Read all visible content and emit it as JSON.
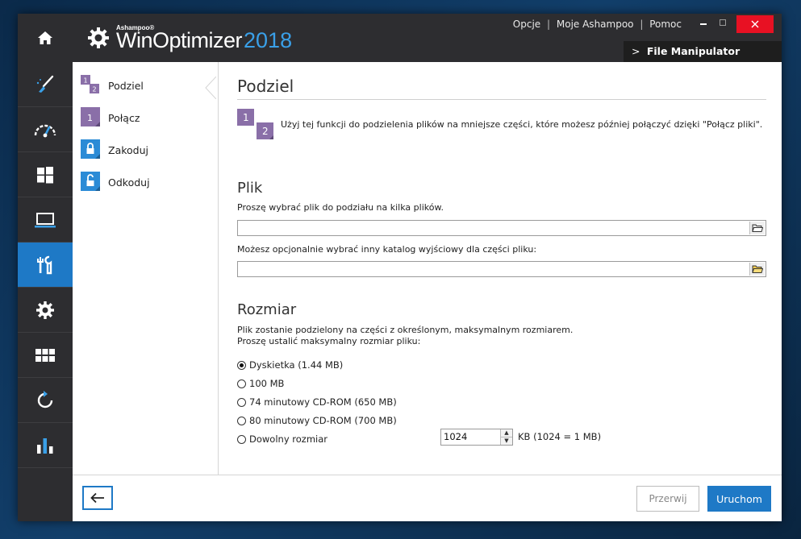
{
  "app": {
    "brand_small": "Ashampoo®",
    "name": "WinOptimizer",
    "year": "2018"
  },
  "top_menu": {
    "options": "Opcje",
    "my_ashampoo": "Moje Ashampoo",
    "help": "Pomoc",
    "separator": "|"
  },
  "breadcrumb": {
    "chevron": ">",
    "label": "File Manipulator"
  },
  "sidebar": {
    "items": [
      {
        "icon": "broom-icon"
      },
      {
        "icon": "speedometer-icon"
      },
      {
        "icon": "windows-icon"
      },
      {
        "icon": "laptop-icon"
      },
      {
        "icon": "tools-icon",
        "active": true
      },
      {
        "icon": "gear-icon"
      },
      {
        "icon": "grid-icon"
      },
      {
        "icon": "restore-icon"
      },
      {
        "icon": "stats-icon"
      }
    ]
  },
  "subnav": {
    "items": [
      {
        "label": "Podziel",
        "icon": "split-icon",
        "active": true
      },
      {
        "label": "Połącz",
        "icon": "merge-icon"
      },
      {
        "label": "Zakoduj",
        "icon": "lock-icon"
      },
      {
        "label": "Odkoduj",
        "icon": "unlock-icon"
      }
    ]
  },
  "main": {
    "title": "Podziel",
    "intro": "Użyj tej funkcji do podzielenia plików na mniejsze części, które możesz później połączyć dzięki \"Połącz pliki\".",
    "file_section": {
      "heading": "Plik",
      "file_label": "Proszę wybrać plik do podziału na kilka plików.",
      "file_value": "",
      "dir_label": "Możesz opcjonalnie wybrać inny katalog wyjściowy dla części pliku:",
      "dir_value": ""
    },
    "size_section": {
      "heading": "Rozmiar",
      "desc_line1": "Plik zostanie podzielony na części z określonym, maksymalnym rozmiarem.",
      "desc_line2": "Proszę ustalić maksymalny rozmiar pliku:",
      "options": [
        {
          "label": "Dyskietka (1.44 MB)",
          "checked": true
        },
        {
          "label": "100 MB",
          "checked": false
        },
        {
          "label": "74 minutowy CD-ROM (650 MB)",
          "checked": false
        },
        {
          "label": "80 minutowy CD-ROM (700 MB)",
          "checked": false
        },
        {
          "label": "Dowolny rozmiar",
          "checked": false
        }
      ],
      "custom_value": "1024",
      "unit_label": "KB (1024 = 1 MB)"
    }
  },
  "footer": {
    "back_icon": "arrow-left-icon",
    "cancel_label": "Przerwij",
    "run_label": "Uruchom"
  },
  "colors": {
    "accent": "#1e79c6",
    "sidebar_bg": "#2d2d30",
    "close_red": "#e81123",
    "year_blue": "#3aa0e8",
    "subnav_purple": "#8a6fa8"
  }
}
